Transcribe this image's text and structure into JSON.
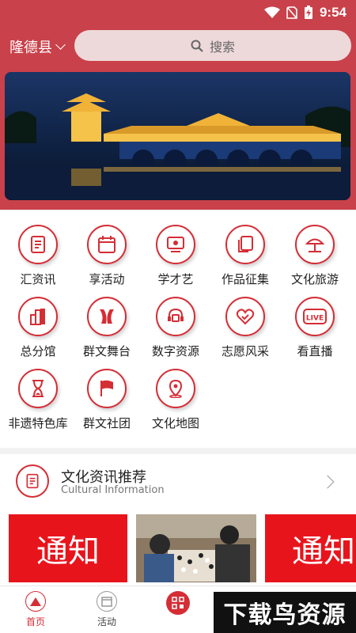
{
  "status": {
    "time": "9:54"
  },
  "header": {
    "location": "隆德县",
    "search_placeholder": "搜索"
  },
  "grid": [
    {
      "label": "汇资讯",
      "icon": "document-icon"
    },
    {
      "label": "享活动",
      "icon": "calendar-icon"
    },
    {
      "label": "学才艺",
      "icon": "teacher-board-icon"
    },
    {
      "label": "作品征集",
      "icon": "files-icon"
    },
    {
      "label": "文化旅游",
      "icon": "beach-umbrella-icon"
    },
    {
      "label": "总分馆",
      "icon": "buildings-icon"
    },
    {
      "label": "群文舞台",
      "icon": "stage-curtain-icon"
    },
    {
      "label": "数字资源",
      "icon": "headset-screen-icon"
    },
    {
      "label": "志愿风采",
      "icon": "heart-handshake-icon"
    },
    {
      "label": "看直播",
      "icon": "live-icon"
    },
    {
      "label": "非遗特色库",
      "icon": "hourglass-icon"
    },
    {
      "label": "群文社团",
      "icon": "flag-icon"
    },
    {
      "label": "文化地图",
      "icon": "map-pin-icon"
    }
  ],
  "recommend": {
    "title": "文化资讯推荐",
    "subtitle": "Cultural Information",
    "cards": [
      {
        "text": "通知"
      },
      {
        "text": ""
      },
      {
        "text": "通知"
      }
    ]
  },
  "tabs": [
    {
      "label": "首页",
      "icon": "home-icon",
      "active": true
    },
    {
      "label": "活动",
      "icon": "activity-icon",
      "active": false
    },
    {
      "label": "",
      "icon": "qr-scan-icon",
      "active": false
    }
  ],
  "watermark": "下载鸟资源",
  "colors": {
    "brand": "#c9414a",
    "accent": "#d52d35",
    "card_red": "#e8141c"
  }
}
